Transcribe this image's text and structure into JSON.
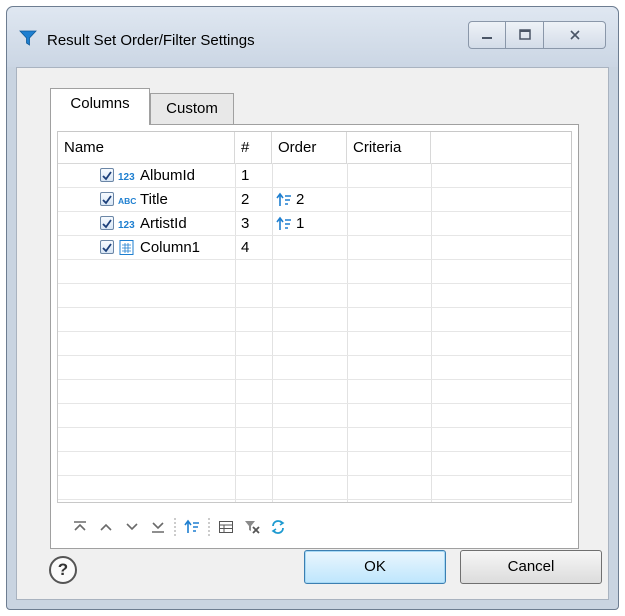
{
  "window": {
    "title": "Result Set Order/Filter Settings",
    "controls": {
      "minimize_icon": "minimize-icon",
      "maximize_icon": "maximize-icon",
      "close_icon": "close-icon"
    }
  },
  "tabs": [
    {
      "label": "Columns",
      "active": true
    },
    {
      "label": "Custom",
      "active": false
    }
  ],
  "table": {
    "headers": {
      "name": "Name",
      "num": "#",
      "order": "Order",
      "criteria": "Criteria"
    },
    "rows": [
      {
        "checked": true,
        "type_icon": "number-type-icon",
        "name": "AlbumId",
        "num": "1",
        "order": "",
        "criteria": ""
      },
      {
        "checked": true,
        "type_icon": "text-type-icon",
        "name": "Title",
        "num": "2",
        "order": "2",
        "criteria": ""
      },
      {
        "checked": true,
        "type_icon": "number-type-icon",
        "name": "ArtistId",
        "num": "3",
        "order": "1",
        "criteria": ""
      },
      {
        "checked": true,
        "type_icon": "table-cell-type-icon",
        "name": "Column1",
        "num": "4",
        "order": "",
        "criteria": ""
      }
    ]
  },
  "toolbar": {
    "icons": [
      "move-top-icon",
      "move-up-icon",
      "move-down-icon",
      "move-bottom-icon",
      "sort-order-icon",
      "table-view-icon",
      "clear-filter-icon",
      "refresh-icon"
    ]
  },
  "buttons": {
    "ok": "OK",
    "cancel": "Cancel",
    "help_icon": "help-icon"
  },
  "colors": {
    "accent": "#1e7fd0",
    "title_bar": "#cbd6e4"
  }
}
